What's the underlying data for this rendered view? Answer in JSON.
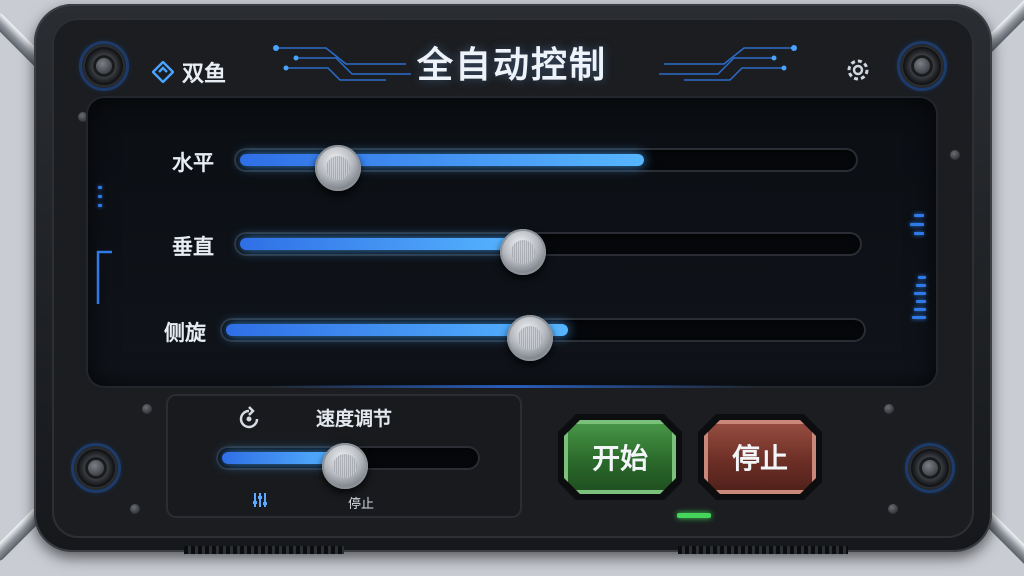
{
  "header": {
    "title": "全自动控制",
    "brand_name": "双鱼",
    "brand_icon": "fish-logo-icon",
    "settings_icon": "gear-icon"
  },
  "sliders": [
    {
      "label": "水平",
      "level_percent": 66,
      "knob_percent": 16
    },
    {
      "label": "垂直",
      "level_percent": 46,
      "knob_percent": 46
    },
    {
      "label": "侧旋",
      "level_percent": 54,
      "knob_percent": 48
    }
  ],
  "speed": {
    "title": "速度调节",
    "status": "停止",
    "level_percent": 49,
    "icon": "rotate-speed-icon",
    "equalizer_icon": "equalizer-icon"
  },
  "buttons": {
    "start": "开始",
    "stop": "停止"
  },
  "colors": {
    "accent": "#4aa3ff",
    "start": "#3d8a3d",
    "stop": "#7a3a30",
    "led": "#44d65a"
  }
}
